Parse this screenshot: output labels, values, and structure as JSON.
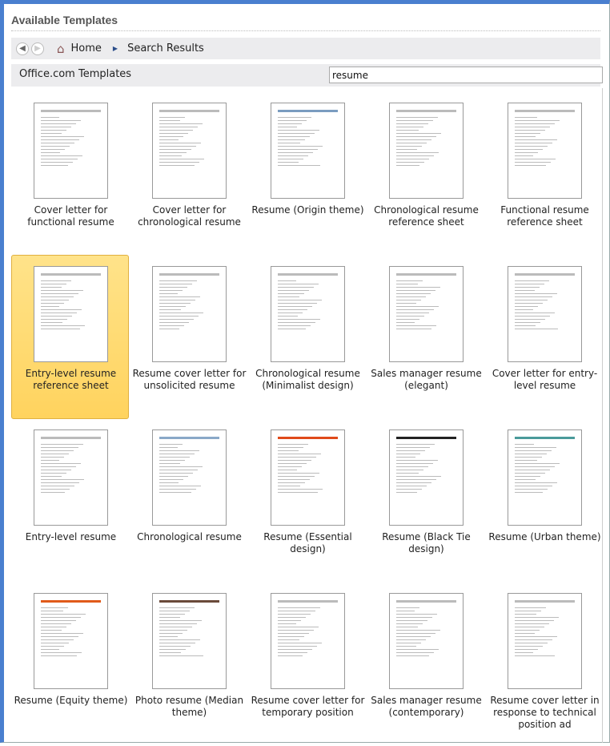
{
  "header": {
    "title": "Available Templates"
  },
  "nav": {
    "back": "◀",
    "forward": "▶",
    "home": "Home",
    "current": "Search Results"
  },
  "source": {
    "label": "Office.com Templates",
    "search_value": "resume"
  },
  "colors": {
    "frame": "#4a7fcf",
    "selected": "#ffd35e"
  },
  "templates": [
    {
      "label": "Cover letter for functional resume",
      "accent": "#bbbbbb"
    },
    {
      "label": "Cover letter for chronological resume",
      "accent": "#bbbbbb"
    },
    {
      "label": "Resume (Origin theme)",
      "accent": "#7a9cc0"
    },
    {
      "label": "Chronological resume reference sheet",
      "accent": "#bbbbbb"
    },
    {
      "label": "Functional resume reference sheet",
      "accent": "#bbbbbb"
    },
    {
      "label": "Entry-level resume reference sheet",
      "accent": "#bbbbbb",
      "selected": true
    },
    {
      "label": "Resume cover letter for unsolicited resume",
      "accent": "#bbbbbb"
    },
    {
      "label": "Chronological resume (Minimalist design)",
      "accent": "#bbbbbb"
    },
    {
      "label": "Sales manager resume (elegant)",
      "accent": "#bbbbbb"
    },
    {
      "label": "Cover letter for entry-level resume",
      "accent": "#bbbbbb"
    },
    {
      "label": "Entry-level resume",
      "accent": "#bbbbbb"
    },
    {
      "label": "Chronological resume",
      "accent": "#8aa8c8"
    },
    {
      "label": "Resume (Essential design)",
      "accent": "#e04a1a"
    },
    {
      "label": "Resume (Black Tie design)",
      "accent": "#222222"
    },
    {
      "label": "Resume (Urban theme)",
      "accent": "#4a9a9a"
    },
    {
      "label": "Resume (Equity theme)",
      "accent": "#e05a1a"
    },
    {
      "label": "Photo resume (Median theme)",
      "accent": "#6a4a3a"
    },
    {
      "label": "Resume cover letter for temporary position",
      "accent": "#bbbbbb"
    },
    {
      "label": "Sales manager resume (contemporary)",
      "accent": "#bbbbbb"
    },
    {
      "label": "Resume cover letter in response to technical position ad",
      "accent": "#bbbbbb"
    }
  ]
}
